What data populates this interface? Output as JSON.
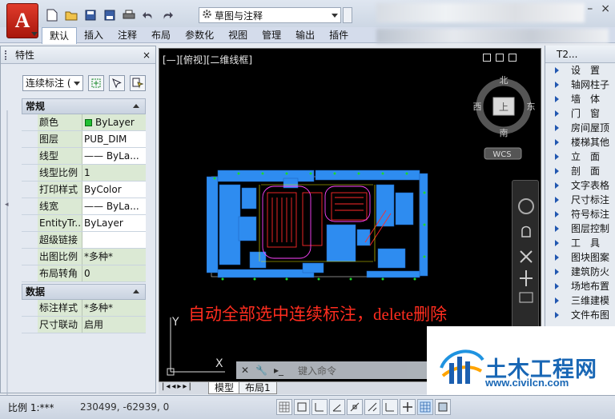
{
  "app": {
    "logo_letter": "A",
    "workspace": "草图与注释"
  },
  "ribbon": {
    "tabs": [
      {
        "label": "默认",
        "active": true
      },
      {
        "label": "插入"
      },
      {
        "label": "注释"
      },
      {
        "label": "布局"
      },
      {
        "label": "参数化"
      },
      {
        "label": "视图"
      },
      {
        "label": "管理"
      },
      {
        "label": "输出"
      },
      {
        "label": "插件"
      }
    ]
  },
  "properties": {
    "title": "特性",
    "selector": "连续标注 (",
    "sections": [
      {
        "name": "常规",
        "rows": [
          {
            "name": "颜色",
            "value": "ByLayer",
            "swatch": "#22c032",
            "green": true
          },
          {
            "name": "图层",
            "value": "PUB_DIM"
          },
          {
            "name": "线型",
            "value": "—— ByLa..."
          },
          {
            "name": "线型比例",
            "value": "1",
            "green": true
          },
          {
            "name": "打印样式",
            "value": "ByColor"
          },
          {
            "name": "线宽",
            "value": "—— ByLa..."
          },
          {
            "name": "EntityTr...",
            "value": "ByLayer"
          },
          {
            "name": "超级链接",
            "value": ""
          },
          {
            "name": "出图比例",
            "value": "*多种*",
            "green": true
          },
          {
            "name": "布局转角",
            "value": "0",
            "green": true
          }
        ]
      },
      {
        "name": "数据",
        "rows": [
          {
            "name": "标注样式",
            "value": "*多种*",
            "green": true
          },
          {
            "name": "尺寸联动",
            "value": "启用",
            "green": true
          }
        ]
      }
    ]
  },
  "viewport": {
    "label": "[—][俯视][二维线框]",
    "viewcube": {
      "north": "北",
      "south": "南",
      "east": "东",
      "west": "西",
      "top": "上",
      "wcs": "WCS"
    },
    "caption": "自动全部选中连续标注，delete删除",
    "command_placeholder": "键入命令",
    "layout_tabs": [
      "模型",
      "布局1"
    ]
  },
  "right_panel": {
    "title": "T2...",
    "items": [
      "设　置",
      "轴网柱子",
      "墙　体",
      "门　窗",
      "房间屋顶",
      "楼梯其他",
      "立　面",
      "剖　面",
      "文字表格",
      "尺寸标注",
      "符号标注",
      "图层控制",
      "工　具",
      "图块图案",
      "建筑防火",
      "场地布置",
      "三维建模",
      "文件布图"
    ]
  },
  "statusbar": {
    "scale": "比例 1:***",
    "coords": "230499, -62939, 0"
  },
  "watermark": {
    "title": "土木工程网",
    "url": "www.civilcn.com"
  }
}
